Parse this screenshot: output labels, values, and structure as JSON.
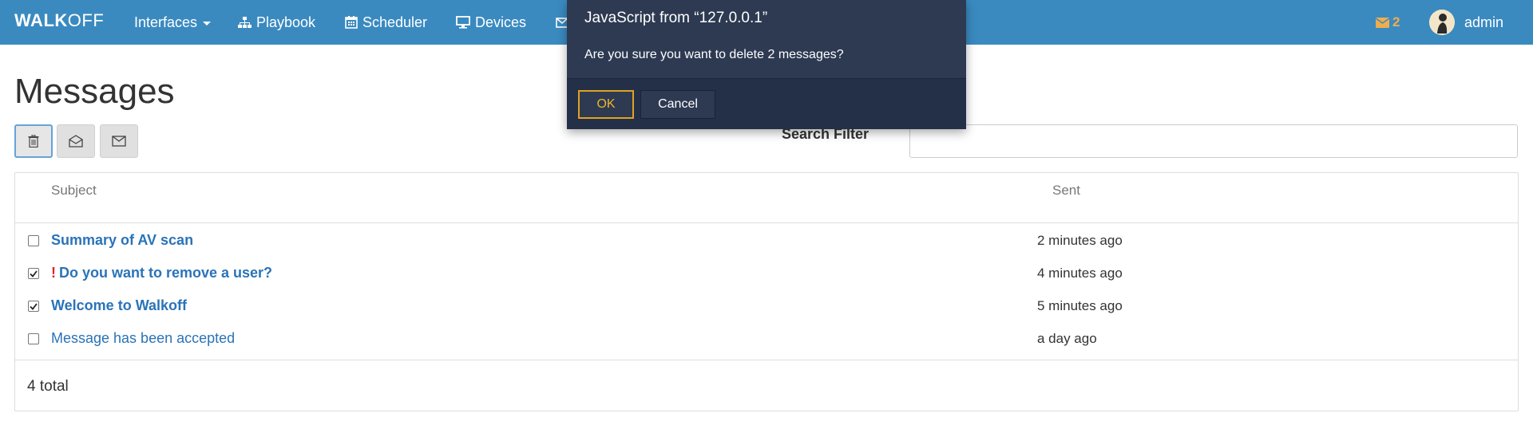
{
  "navbar": {
    "brand_bold": "WALK",
    "brand_light": "OFF",
    "items": [
      {
        "label": "Interfaces",
        "icon": "dropdown"
      },
      {
        "label": "Playbook",
        "icon": "sitemap-icon"
      },
      {
        "label": "Scheduler",
        "icon": "calendar-icon"
      },
      {
        "label": "Devices",
        "icon": "desktop-icon"
      }
    ],
    "message_count": "2",
    "user_name": "admin"
  },
  "page": {
    "title": "Messages",
    "search_label": "Search Filter",
    "search_value": ""
  },
  "table": {
    "columns": {
      "subject": "Subject",
      "sent": "Sent"
    },
    "rows": [
      {
        "subject": "Summary of AV scan",
        "sent": "2 minutes ago",
        "checked": false,
        "important": false,
        "unread": true
      },
      {
        "subject": "Do you want to remove a user?",
        "sent": "4 minutes ago",
        "checked": true,
        "important": true,
        "unread": true
      },
      {
        "subject": "Welcome to Walkoff",
        "sent": "5 minutes ago",
        "checked": true,
        "important": false,
        "unread": true
      },
      {
        "subject": "Message has been accepted",
        "sent": "a day ago",
        "checked": false,
        "important": false,
        "unread": false
      }
    ],
    "important_mark": "!",
    "total": "4 total"
  },
  "dialog": {
    "title": "JavaScript from “127.0.0.1”",
    "message": "Are you sure you want to delete 2 messages?",
    "ok_label": "OK",
    "cancel_label": "Cancel"
  },
  "colors": {
    "navbar": "#3a8ac0",
    "link": "#2a73b8",
    "important": "#d9262c",
    "badge": "#f0ad4e",
    "dialog_bg": "#2d3a52",
    "ok_border": "#e0a31f"
  }
}
